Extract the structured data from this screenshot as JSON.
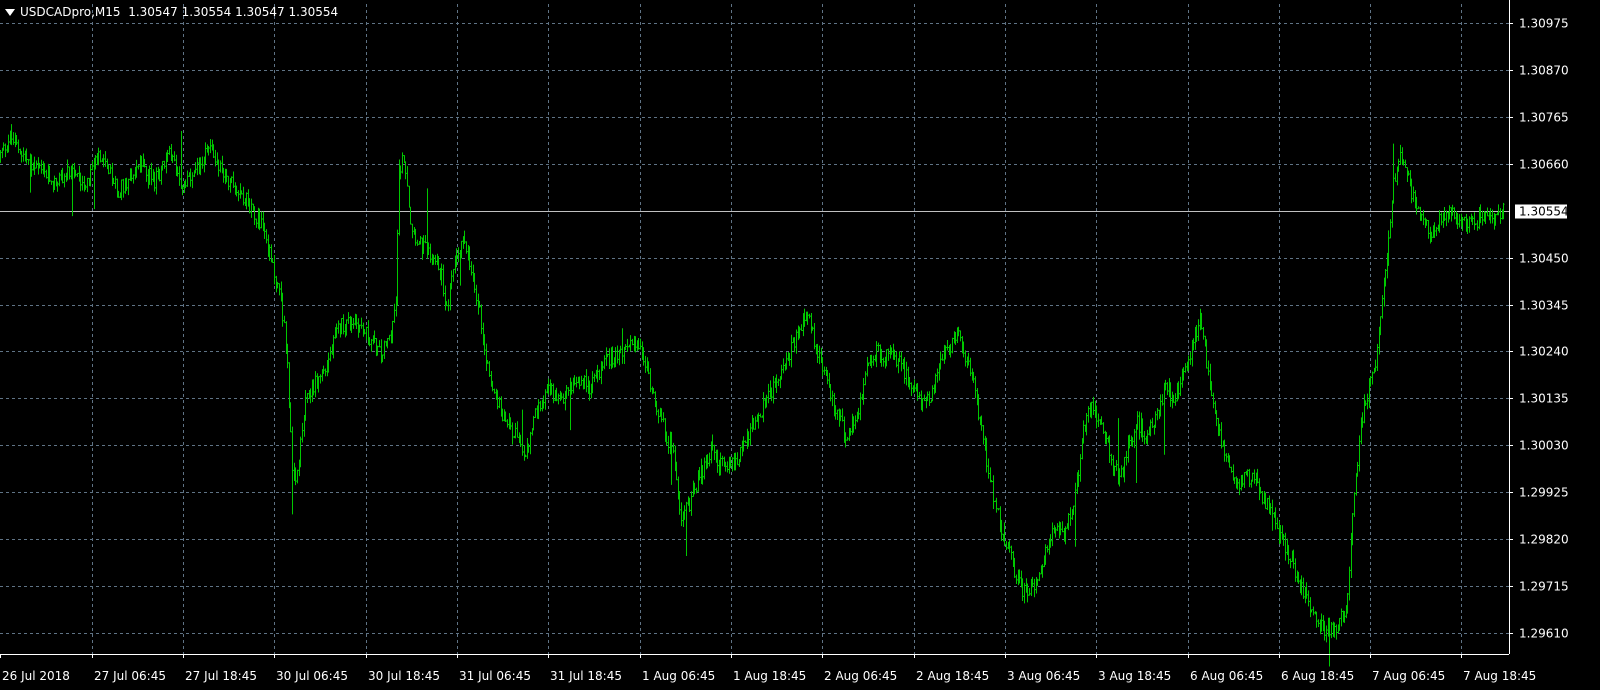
{
  "header": {
    "symbol_info": "USDCADpro,M15",
    "ohlc": "1.30547 1.30554 1.30547 1.30554"
  },
  "colors": {
    "background": "#000000",
    "grid": "#5f7385",
    "bars": "#00c800",
    "axis_text": "#ffffff",
    "price_line": "#c0c0c0"
  },
  "chart_data": {
    "type": "bar",
    "symbol": "USDCADpro",
    "timeframe": "M15",
    "grid": true,
    "current_price": 1.30554,
    "current_price_label": "1.30554",
    "ylim": [
      1.2958,
      1.31005
    ],
    "y_ticks": [
      "1.30975",
      "1.30870",
      "1.30765",
      "1.30660",
      "1.30450",
      "1.30345",
      "1.30240",
      "1.30135",
      "1.30030",
      "1.29925",
      "1.29820",
      "1.29715",
      "1.29610"
    ],
    "x_labels": [
      "26 Jul 2018",
      "27 Jul 06:45",
      "27 Jul 18:45",
      "30 Jul 06:45",
      "30 Jul 18:45",
      "31 Jul 06:45",
      "31 Jul 18:45",
      "1 Aug 06:45",
      "1 Aug 18:45",
      "2 Aug 06:45",
      "2 Aug 18:45",
      "3 Aug 06:45",
      "3 Aug 18:45",
      "6 Aug 06:45",
      "6 Aug 18:45",
      "7 Aug 06:45",
      "7 Aug 18:45"
    ],
    "price_path": [
      [
        0,
        1.3068
      ],
      [
        6,
        1.3072
      ],
      [
        18,
        1.3066
      ],
      [
        33,
        1.3062
      ],
      [
        42,
        1.3064
      ],
      [
        52,
        1.3062
      ],
      [
        60,
        1.3068
      ],
      [
        72,
        1.306
      ],
      [
        85,
        1.3066
      ],
      [
        94,
        1.3062
      ],
      [
        103,
        1.3068
      ],
      [
        112,
        1.3061
      ],
      [
        118,
        1.3063
      ],
      [
        127,
        1.307
      ],
      [
        136,
        1.3064
      ],
      [
        145,
        1.306
      ],
      [
        150,
        1.3058
      ],
      [
        160,
        1.3052
      ],
      [
        165,
        1.3044
      ],
      [
        171,
        1.3036
      ],
      [
        175,
        1.3022
      ],
      [
        178,
        1.2996
      ],
      [
        180,
        1.2994
      ],
      [
        186,
        1.3012
      ],
      [
        190,
        1.3016
      ],
      [
        198,
        1.302
      ],
      [
        207,
        1.303
      ],
      [
        216,
        1.3031
      ],
      [
        225,
        1.3027
      ],
      [
        232,
        1.3023
      ],
      [
        238,
        1.3028
      ],
      [
        241,
        1.3035
      ],
      [
        243,
        1.3064
      ],
      [
        246,
        1.3068
      ],
      [
        248,
        1.3062
      ],
      [
        250,
        1.3053
      ],
      [
        255,
        1.3048
      ],
      [
        262,
        1.3046
      ],
      [
        269,
        1.3041
      ],
      [
        272,
        1.3033
      ],
      [
        278,
        1.3046
      ],
      [
        283,
        1.3049
      ],
      [
        287,
        1.3041
      ],
      [
        292,
        1.3033
      ],
      [
        296,
        1.3022
      ],
      [
        300,
        1.3016
      ],
      [
        306,
        1.301
      ],
      [
        313,
        1.3006
      ],
      [
        320,
        1.3
      ],
      [
        326,
        1.301
      ],
      [
        333,
        1.3016
      ],
      [
        341,
        1.3013
      ],
      [
        350,
        1.3018
      ],
      [
        360,
        1.3016
      ],
      [
        369,
        1.3022
      ],
      [
        378,
        1.3024
      ],
      [
        388,
        1.3026
      ],
      [
        394,
        1.302
      ],
      [
        400,
        1.3012
      ],
      [
        405,
        1.3006
      ],
      [
        411,
        1.3
      ],
      [
        415,
        1.2987
      ],
      [
        420,
        1.299
      ],
      [
        426,
        1.2996
      ],
      [
        433,
        1.3002
      ],
      [
        441,
        1.2998
      ],
      [
        448,
        1.2999
      ],
      [
        455,
        1.3005
      ],
      [
        463,
        1.301
      ],
      [
        471,
        1.3016
      ],
      [
        480,
        1.3023
      ],
      [
        487,
        1.3028
      ],
      [
        491,
        1.3033
      ],
      [
        495,
        1.3028
      ],
      [
        500,
        1.3021
      ],
      [
        506,
        1.3014
      ],
      [
        512,
        1.3008
      ],
      [
        516,
        1.3004
      ],
      [
        522,
        1.301
      ],
      [
        528,
        1.302
      ],
      [
        534,
        1.3024
      ],
      [
        541,
        1.3023
      ],
      [
        548,
        1.3022
      ],
      [
        555,
        1.3016
      ],
      [
        562,
        1.3013
      ],
      [
        568,
        1.3015
      ],
      [
        573,
        1.3022
      ],
      [
        578,
        1.3024
      ],
      [
        583,
        1.3029
      ],
      [
        587,
        1.3024
      ],
      [
        592,
        1.3018
      ],
      [
        597,
        1.3009
      ],
      [
        601,
        1.3
      ],
      [
        606,
        1.299
      ],
      [
        612,
        1.2982
      ],
      [
        618,
        1.2975
      ],
      [
        624,
        1.297
      ],
      [
        630,
        1.2972
      ],
      [
        636,
        1.2978
      ],
      [
        642,
        1.2984
      ],
      [
        648,
        1.2982
      ],
      [
        654,
        1.299
      ],
      [
        660,
        1.3006
      ],
      [
        665,
        1.3012
      ],
      [
        671,
        1.3008
      ],
      [
        677,
        1.3
      ],
      [
        682,
        1.2995
      ],
      [
        688,
        1.3004
      ],
      [
        693,
        1.3008
      ],
      [
        699,
        1.3005
      ],
      [
        705,
        1.301
      ],
      [
        710,
        1.3016
      ],
      [
        716,
        1.3013
      ],
      [
        722,
        1.302
      ],
      [
        727,
        1.3026
      ],
      [
        731,
        1.3031
      ],
      [
        735,
        1.3022
      ],
      [
        739,
        1.3013
      ],
      [
        743,
        1.3005
      ],
      [
        748,
        1.3
      ],
      [
        753,
        1.2994
      ],
      [
        759,
        1.2996
      ],
      [
        765,
        1.2995
      ],
      [
        771,
        1.299
      ],
      [
        777,
        1.2986
      ],
      [
        783,
        1.298
      ],
      [
        789,
        1.2975
      ],
      [
        795,
        1.297
      ],
      [
        801,
        1.2965
      ],
      [
        808,
        1.2961
      ],
      [
        815,
        1.2963
      ],
      [
        820,
        1.2966
      ],
      [
        825,
        1.2992
      ],
      [
        829,
        1.3008
      ],
      [
        833,
        1.3014
      ],
      [
        838,
        1.3022
      ],
      [
        844,
        1.3042
      ],
      [
        849,
        1.3062
      ],
      [
        853,
        1.3068
      ],
      [
        857,
        1.3064
      ],
      [
        861,
        1.3058
      ],
      [
        866,
        1.3053
      ],
      [
        872,
        1.3051
      ],
      [
        880,
        1.3055
      ],
      [
        888,
        1.3054
      ],
      [
        896,
        1.3052
      ],
      [
        904,
        1.3055
      ],
      [
        910,
        1.3054
      ],
      [
        916,
        1.3056
      ]
    ]
  }
}
